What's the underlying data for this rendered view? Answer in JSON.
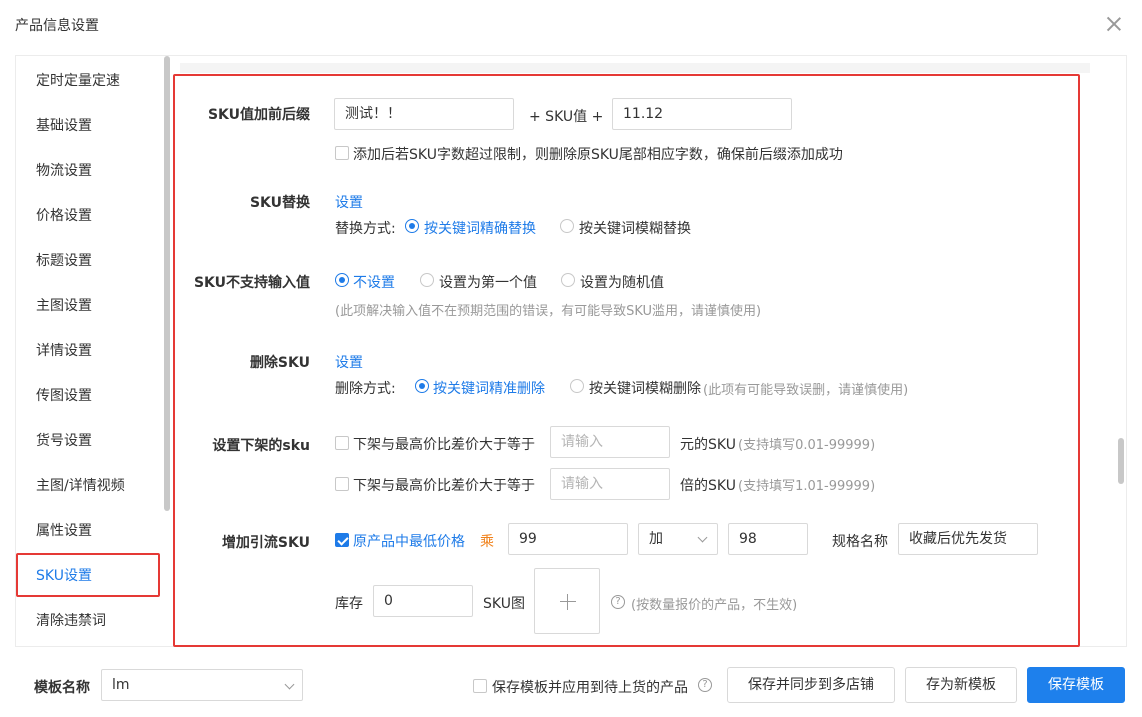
{
  "dialog": {
    "title": "产品信息设置"
  },
  "sidebar": {
    "items": [
      {
        "label": "定时定量定速"
      },
      {
        "label": "基础设置"
      },
      {
        "label": "物流设置"
      },
      {
        "label": "价格设置"
      },
      {
        "label": "标题设置"
      },
      {
        "label": "主图设置"
      },
      {
        "label": "详情设置"
      },
      {
        "label": "传图设置"
      },
      {
        "label": "货号设置"
      },
      {
        "label": "主图/详情视频"
      },
      {
        "label": "属性设置"
      },
      {
        "label": "SKU设置"
      },
      {
        "label": "清除违禁词"
      }
    ],
    "active": "SKU设置"
  },
  "sku_prefix_suffix": {
    "label": "SKU值加前后缀",
    "prefix_value": "测试！！",
    "middle_text": "+ SKU值 +",
    "suffix_value": "11.12",
    "truncate_checkbox_label": "添加后若SKU字数超过限制，则删除原SKU尾部相应字数，确保前后缀添加成功",
    "truncate_checked": false
  },
  "sku_replace": {
    "label": "SKU替换",
    "settings_link": "设置",
    "method_label": "替换方式:",
    "options": [
      "按关键词精确替换",
      "按关键词模糊替换"
    ],
    "selected": "按关键词精确替换"
  },
  "sku_unsupported": {
    "label": "SKU不支持输入值",
    "options": [
      "不设置",
      "设置为第一个值",
      "设置为随机值"
    ],
    "selected": "不设置",
    "hint": "(此项解决输入值不在预期范围的错误，有可能导致SKU滥用，请谨慎使用)"
  },
  "sku_delete": {
    "label": "删除SKU",
    "settings_link": "设置",
    "method_label": "删除方式:",
    "options": [
      "按关键词精准删除",
      "按关键词模糊删除"
    ],
    "selected": "按关键词精准删除",
    "hint": "(此项有可能导致误删，请谨慎使用)"
  },
  "sku_offshelf": {
    "label": "设置下架的sku",
    "rule1": {
      "checkbox_label": "下架与最高价比差价大于等于",
      "placeholder": "请输入",
      "unit": "元的SKU",
      "hint": "(支持填写0.01-99999)",
      "checked": false
    },
    "rule2": {
      "checkbox_label": "下架与最高价比差价大于等于",
      "placeholder": "请输入",
      "unit": "倍的SKU",
      "hint": "(支持填写1.01-99999)",
      "checked": false
    }
  },
  "sku_traffic": {
    "label": "增加引流SKU",
    "lowest_price_label": "原产品中最低价格",
    "lowest_price_checked": true,
    "multiply_label": "乘",
    "multiply_value": "99",
    "operator_value": "加",
    "add_value": "98",
    "spec_name_label": "规格名称",
    "spec_name_value": "收藏后优先发货",
    "stock_label": "库存",
    "stock_value": "0",
    "sku_image_label": "SKU图",
    "help_hint": "(按数量报价的产品，不生效)"
  },
  "footer": {
    "template_name_label": "模板名称",
    "template_name_value": "lm",
    "apply_checkbox_label": "保存模板并应用到待上货的产品",
    "apply_checked": false,
    "sync_button": "保存并同步到多店铺",
    "save_new_button": "存为新模板",
    "save_button": "保存模板"
  },
  "colors": {
    "accent": "#1e7be8",
    "highlight_frame": "#e53935",
    "multiply_label": "#f0811a"
  },
  "icons": {
    "close": "close-icon",
    "help": "help-circle-icon",
    "dropdown": "chevron-down-icon",
    "upload": "plus-icon"
  }
}
